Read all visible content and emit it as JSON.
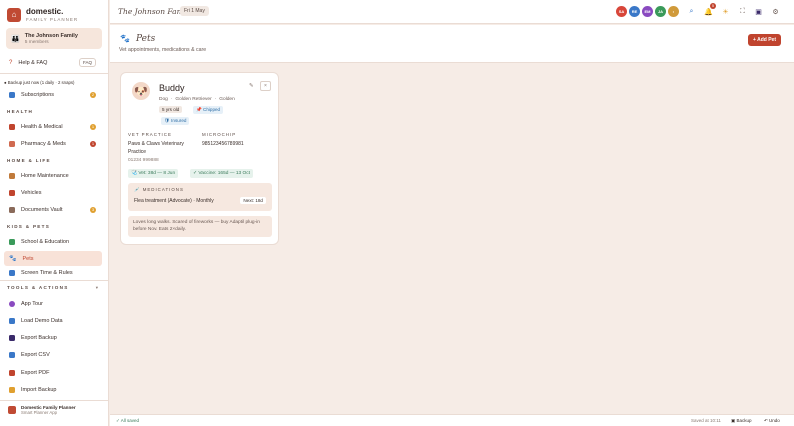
{
  "brand": {
    "name": "domestic.",
    "sub": "FAMILY PLANNER"
  },
  "family": {
    "name": "The Johnson Family",
    "members": "5 members"
  },
  "sidebar": {
    "help": {
      "label": "Help & FAQ",
      "badge": "FAQ"
    },
    "backup_note": "Backup just now (1 daily · 2 snaps)",
    "subscriptions": {
      "label": "Subscriptions",
      "badge": "2"
    },
    "health_section": "HEALTH",
    "health_medical": {
      "label": "Health & Medical",
      "badge": "1"
    },
    "pharmacy": {
      "label": "Pharmacy & Meds",
      "badge": "1"
    },
    "home_section": "HOME & LIFE",
    "home_maintenance": {
      "label": "Home Maintenance"
    },
    "vehicles": {
      "label": "Vehicles"
    },
    "documents": {
      "label": "Documents Vault",
      "badge": "3"
    },
    "kids_section": "KIDS & PETS",
    "school": {
      "label": "School & Education"
    },
    "pets": {
      "label": "Pets"
    },
    "screen_time": {
      "label": "Screen Time & Rules"
    },
    "tools_section": "TOOLS & ACTIONS",
    "tools": [
      {
        "label": "App Tour"
      },
      {
        "label": "Load Demo Data"
      },
      {
        "label": "Export Backup"
      },
      {
        "label": "Export CSV"
      },
      {
        "label": "Export PDF"
      },
      {
        "label": "Import Backup"
      }
    ],
    "footer": {
      "name": "Domestic Family Planner",
      "sub": "Smart Planner App"
    }
  },
  "topbar": {
    "title": "The Johnson Family",
    "date": "Fri 1 May",
    "avatars": [
      {
        "initials": "SA",
        "color": "#d8463a"
      },
      {
        "initials": "RE",
        "color": "#3a78c8"
      },
      {
        "initials": "EM",
        "color": "#8a4ac0"
      },
      {
        "initials": "JA",
        "color": "#3a9a5a"
      },
      {
        "initials": "•",
        "color": "#d09a3a"
      }
    ],
    "notif_count": "5"
  },
  "page": {
    "title": "Pets",
    "subtitle": "Vet appointments, medications & care",
    "add_button": "+ Add Pet"
  },
  "pet": {
    "name": "Buddy",
    "species": "Dog",
    "breed": "Golden Retriever",
    "color": "Golden",
    "age": "5 yrs old",
    "chipped": "Chipped",
    "insured": "Insured",
    "vet_label": "VET PRACTICE",
    "vet_name_line1": "Paws & Claws Veterinary",
    "vet_name_line2": "Practice",
    "vet_phone": "01234 999888",
    "microchip_label": "MICROCHIP",
    "microchip": "985123456789981",
    "vet_due": "Vet: 38d — 8 Jun",
    "vaccine_due": "Vaccine: 165d — 13 Oct",
    "medications_label": "MEDICATIONS",
    "medication": "Flea treatment (Advocate) · Monthly",
    "medication_next": "Next: 18d",
    "notes": "Loves long walks. Scared of fireworks — buy Adaptil plug-in before Nov. Eats 2×daily."
  },
  "statusbar": {
    "saved": "✓ All saved",
    "time": "Saved at 10:11",
    "backup": "Backup",
    "undo": "Undo"
  }
}
